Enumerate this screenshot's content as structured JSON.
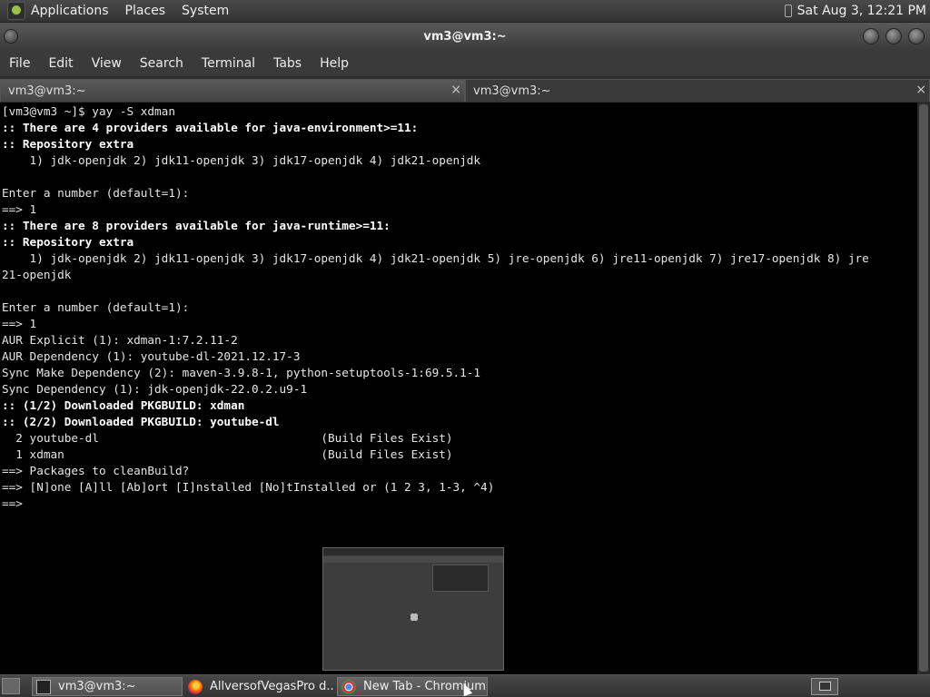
{
  "top_panel": {
    "menus": [
      "Applications",
      "Places",
      "System"
    ],
    "clock": "Sat Aug  3, 12:21 PM"
  },
  "window": {
    "title": "vm3@vm3:~"
  },
  "menubar": {
    "items": [
      "File",
      "Edit",
      "View",
      "Search",
      "Terminal",
      "Tabs",
      "Help"
    ]
  },
  "tabs": [
    {
      "label": "vm3@vm3:~",
      "close": "×"
    },
    {
      "label": "vm3@vm3:~",
      "close": "×"
    }
  ],
  "terminal": {
    "lines": [
      {
        "text": "[vm3@vm3 ~]$ yay -S xdman",
        "bold": false
      },
      {
        "text": ":: There are 4 providers available for java-environment>=11:",
        "bold": true
      },
      {
        "text": ":: Repository extra",
        "bold": true
      },
      {
        "text": "    1) jdk-openjdk 2) jdk11-openjdk 3) jdk17-openjdk 4) jdk21-openjdk",
        "bold": false
      },
      {
        "text": "",
        "bold": false
      },
      {
        "text": "Enter a number (default=1):",
        "bold": false
      },
      {
        "text": "==> 1",
        "bold": false
      },
      {
        "text": ":: There are 8 providers available for java-runtime>=11:",
        "bold": true
      },
      {
        "text": ":: Repository extra",
        "bold": true
      },
      {
        "text": "    1) jdk-openjdk 2) jdk11-openjdk 3) jdk17-openjdk 4) jdk21-openjdk 5) jre-openjdk 6) jre11-openjdk 7) jre17-openjdk 8) jre",
        "bold": false
      },
      {
        "text": "21-openjdk",
        "bold": false
      },
      {
        "text": "",
        "bold": false
      },
      {
        "text": "Enter a number (default=1):",
        "bold": false
      },
      {
        "text": "==> 1",
        "bold": false
      },
      {
        "text": "AUR Explicit (1): xdman-1:7.2.11-2",
        "bold": false
      },
      {
        "text": "AUR Dependency (1): youtube-dl-2021.12.17-3",
        "bold": false
      },
      {
        "text": "Sync Make Dependency (2): maven-3.9.8-1, python-setuptools-1:69.5.1-1",
        "bold": false
      },
      {
        "text": "Sync Dependency (1): jdk-openjdk-22.0.2.u9-1",
        "bold": false
      },
      {
        "text": ":: (1/2) Downloaded PKGBUILD: xdman",
        "bold": true
      },
      {
        "text": ":: (2/2) Downloaded PKGBUILD: youtube-dl",
        "bold": true
      },
      {
        "text": "  2 youtube-dl                                (Build Files Exist)",
        "bold": false
      },
      {
        "text": "  1 xdman                                     (Build Files Exist)",
        "bold": false
      },
      {
        "text": "==> Packages to cleanBuild?",
        "bold": false
      },
      {
        "text": "==> [N]one [A]ll [Ab]ort [I]nstalled [No]tInstalled or (1 2 3, 1-3, ^4)",
        "bold": false
      },
      {
        "text": "==>",
        "bold": false
      }
    ]
  },
  "taskbar": {
    "tasks": [
      {
        "label": "vm3@vm3:~",
        "icon": "terminal-icon",
        "active": true
      },
      {
        "label": "AllversofVegasPro d...",
        "icon": "firefox-icon",
        "active": false
      },
      {
        "label": "New Tab - Chromium",
        "icon": "chromium-icon",
        "active": true
      }
    ]
  }
}
